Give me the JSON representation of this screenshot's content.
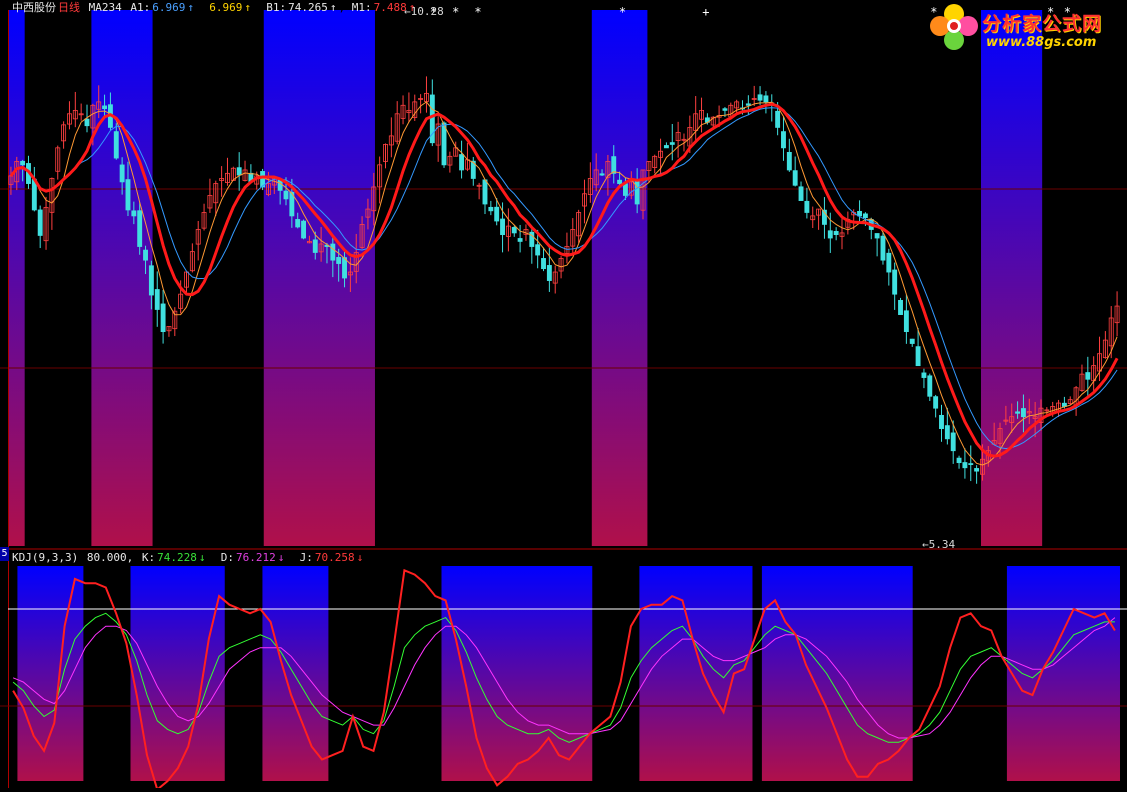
{
  "header": {
    "stock_name": "中西股份",
    "period": "日线",
    "indicator": "MA234",
    "a1_label": "A1:",
    "a1_value": "6.969",
    "a1_arrow": "↑",
    "a2_value": "6.969",
    "a2_arrow": "↑",
    "b1_label": "B1:",
    "b1_value": "74.265",
    "b1_arrow": "↑",
    "m1_label": "M1:",
    "m1_value": "7.488",
    "m1_arrow": "↑"
  },
  "kdj_header": {
    "pane_number": "5",
    "name": "KDJ(9,3,3)",
    "level": "80.000,",
    "k_label": "K:",
    "k_value": "74.228",
    "k_arrow": "↓",
    "d_label": "D:",
    "d_value": "76.212",
    "d_arrow": "↓",
    "j_label": "J:",
    "j_value": "70.258",
    "j_arrow": "↓"
  },
  "watermark": {
    "title": "分析家公式网",
    "url": "www.88gs.com"
  },
  "colors": {
    "band_top": "#0000ff",
    "band_bottom": "#b0104a",
    "bull": "#ff4040",
    "bear": "#40e0e0",
    "thick_ma": "#ff1a1a",
    "mid_ma": "#ff9933",
    "slow_ma": "#3399ff",
    "k_line": "#33ff33",
    "d_line": "#ff33ff",
    "j_line": "#ff2020",
    "ref_line": "#ffffff"
  },
  "chart_data": [
    {
      "type": "candlestick",
      "title": "中西股份 日线",
      "price_annotations": [
        {
          "label": "10.28",
          "kind": "high"
        },
        {
          "label": "5.34",
          "kind": "low"
        }
      ],
      "ylim": [
        4.6,
        10.9
      ],
      "signal_bars": [
        [
          0,
          3
        ],
        [
          15,
          26
        ],
        [
          46,
          66
        ],
        [
          105,
          115
        ],
        [
          175,
          186
        ],
        [
          224,
          234
        ],
        [
          307,
          327
        ]
      ],
      "star_markers": [
        [
          76,
          "*"
        ],
        [
          80,
          "*"
        ],
        [
          84,
          "*"
        ],
        [
          110,
          "*"
        ],
        [
          125,
          "+"
        ],
        [
          166,
          "*"
        ],
        [
          187,
          "*"
        ],
        [
          190,
          "*"
        ],
        [
          210,
          "*"
        ],
        [
          213,
          "*"
        ],
        [
          306,
          "*"
        ]
      ],
      "ohlc_closes": [
        8.95,
        9.12,
        9.08,
        8.86,
        8.55,
        8.25,
        8.58,
        8.92,
        9.28,
        9.55,
        9.68,
        9.72,
        9.68,
        9.54,
        9.78,
        9.82,
        9.74,
        9.52,
        9.16,
        8.88,
        8.55,
        8.48,
        8.12,
        7.96,
        7.55,
        7.38,
        7.12,
        7.18,
        7.36,
        7.56,
        7.82,
        8.06,
        8.32,
        8.52,
        8.72,
        8.86,
        8.92,
        8.98,
        9.04,
        8.96,
        9.02,
        8.88,
        8.95,
        8.82,
        8.86,
        8.92,
        8.78,
        8.68,
        8.48,
        8.35,
        8.22,
        8.18,
        8.05,
        8.15,
        8.12,
        7.96,
        7.92,
        7.75,
        7.82,
        8.05,
        8.38,
        8.56,
        8.82,
        9.08,
        9.32,
        9.42,
        9.68,
        9.78,
        9.72,
        9.82,
        9.86,
        9.92,
        9.34,
        9.56,
        9.08,
        9.18,
        9.28,
        9.02,
        9.14,
        8.92,
        8.84,
        8.62,
        8.54,
        8.42,
        8.26,
        8.36,
        8.28,
        8.18,
        8.32,
        8.12,
        8.02,
        7.86,
        7.72,
        7.82,
        7.98,
        8.12,
        8.32,
        8.52,
        8.74,
        8.92,
        9.02,
        8.96,
        9.12,
        8.98,
        8.86,
        8.72,
        8.88,
        8.62,
        9.02,
        9.12,
        9.18,
        9.24,
        9.28,
        9.32,
        9.46,
        9.38,
        9.52,
        9.68,
        9.72,
        9.58,
        9.64,
        9.66,
        9.72,
        9.78,
        9.82,
        9.74,
        9.78,
        9.86,
        9.84,
        9.82,
        9.78,
        9.52,
        9.28,
        9.02,
        8.84,
        8.66,
        8.52,
        8.48,
        8.56,
        8.38,
        8.22,
        8.26,
        8.28,
        8.44,
        8.52,
        8.48,
        8.46,
        8.32,
        8.22,
        7.96,
        7.82,
        7.56,
        7.32,
        7.12,
        6.98,
        6.72,
        6.58,
        6.36,
        6.22,
        5.98,
        5.86,
        5.72,
        5.58,
        5.52,
        5.56,
        5.48,
        5.62,
        5.72,
        5.84,
        5.98,
        6.08,
        6.12,
        6.16,
        6.12,
        6.18,
        6.12,
        6.22,
        6.2,
        6.24,
        6.28,
        6.24,
        6.32,
        6.46,
        6.62,
        6.56,
        6.72,
        6.86,
        7.02,
        7.28,
        7.42
      ]
    },
    {
      "type": "line",
      "title": "KDJ(9,3,3)",
      "ylim": [
        0,
        100
      ],
      "reference_level": 80,
      "signal_bars": [
        [
          1,
          8
        ],
        [
          13,
          23
        ],
        [
          27,
          34
        ],
        [
          46,
          62
        ],
        [
          67,
          79
        ],
        [
          80,
          96
        ],
        [
          106,
          118
        ]
      ],
      "series": [
        {
          "name": "K",
          "values": [
            46,
            42,
            35,
            30,
            33,
            52,
            66,
            72,
            76,
            78,
            74,
            68,
            56,
            40,
            28,
            24,
            22,
            24,
            32,
            46,
            58,
            62,
            64,
            66,
            68,
            66,
            60,
            52,
            44,
            36,
            30,
            28,
            26,
            30,
            24,
            22,
            28,
            44,
            62,
            68,
            72,
            74,
            76,
            70,
            60,
            48,
            38,
            30,
            26,
            24,
            22,
            22,
            24,
            20,
            18,
            20,
            22,
            24,
            26,
            34,
            48,
            56,
            62,
            66,
            70,
            72,
            66,
            58,
            52,
            48,
            54,
            56,
            62,
            68,
            72,
            70,
            68,
            62,
            56,
            50,
            42,
            34,
            26,
            22,
            20,
            18,
            18,
            20,
            22,
            26,
            32,
            42,
            52,
            58,
            60,
            62,
            58,
            54,
            50,
            48,
            52,
            56,
            62,
            68,
            70,
            72,
            74,
            74
          ]
        },
        {
          "name": "D",
          "values": [
            48,
            46,
            42,
            38,
            36,
            42,
            52,
            62,
            68,
            72,
            72,
            70,
            64,
            54,
            44,
            36,
            30,
            28,
            30,
            36,
            44,
            52,
            56,
            60,
            62,
            62,
            62,
            58,
            52,
            46,
            40,
            36,
            32,
            30,
            28,
            26,
            26,
            34,
            44,
            54,
            62,
            68,
            72,
            72,
            68,
            62,
            54,
            46,
            38,
            32,
            28,
            26,
            26,
            24,
            22,
            22,
            22,
            23,
            24,
            28,
            36,
            44,
            52,
            58,
            62,
            66,
            66,
            62,
            58,
            56,
            56,
            58,
            60,
            62,
            66,
            68,
            68,
            66,
            62,
            58,
            52,
            46,
            38,
            32,
            26,
            22,
            20,
            20,
            21,
            22,
            26,
            32,
            40,
            48,
            54,
            58,
            58,
            56,
            54,
            52,
            52,
            54,
            58,
            62,
            66,
            70,
            72,
            76
          ]
        },
        {
          "name": "J",
          "values": [
            42,
            34,
            21,
            14,
            27,
            72,
            94,
            92,
            92,
            90,
            78,
            64,
            40,
            12,
            -4,
            0,
            6,
            16,
            36,
            66,
            86,
            82,
            80,
            78,
            80,
            74,
            56,
            40,
            28,
            16,
            10,
            12,
            14,
            30,
            16,
            14,
            32,
            64,
            98,
            96,
            92,
            86,
            84,
            66,
            44,
            20,
            6,
            -2,
            2,
            8,
            10,
            14,
            20,
            12,
            10,
            16,
            22,
            26,
            30,
            46,
            72,
            80,
            82,
            82,
            86,
            84,
            66,
            50,
            40,
            32,
            50,
            52,
            66,
            80,
            84,
            74,
            68,
            54,
            44,
            34,
            22,
            10,
            2,
            2,
            8,
            10,
            14,
            20,
            24,
            34,
            44,
            62,
            76,
            78,
            72,
            70,
            58,
            50,
            42,
            40,
            52,
            60,
            70,
            80,
            78,
            76,
            78,
            70
          ]
        }
      ]
    }
  ]
}
